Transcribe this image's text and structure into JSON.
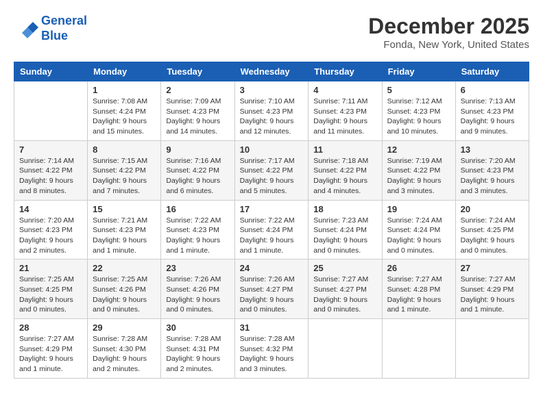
{
  "header": {
    "logo_line1": "General",
    "logo_line2": "Blue",
    "month_title": "December 2025",
    "location": "Fonda, New York, United States"
  },
  "weekdays": [
    "Sunday",
    "Monday",
    "Tuesday",
    "Wednesday",
    "Thursday",
    "Friday",
    "Saturday"
  ],
  "weeks": [
    [
      {
        "day": "",
        "sunrise": "",
        "sunset": "",
        "daylight": ""
      },
      {
        "day": "1",
        "sunrise": "Sunrise: 7:08 AM",
        "sunset": "Sunset: 4:24 PM",
        "daylight": "Daylight: 9 hours and 15 minutes."
      },
      {
        "day": "2",
        "sunrise": "Sunrise: 7:09 AM",
        "sunset": "Sunset: 4:23 PM",
        "daylight": "Daylight: 9 hours and 14 minutes."
      },
      {
        "day": "3",
        "sunrise": "Sunrise: 7:10 AM",
        "sunset": "Sunset: 4:23 PM",
        "daylight": "Daylight: 9 hours and 12 minutes."
      },
      {
        "day": "4",
        "sunrise": "Sunrise: 7:11 AM",
        "sunset": "Sunset: 4:23 PM",
        "daylight": "Daylight: 9 hours and 11 minutes."
      },
      {
        "day": "5",
        "sunrise": "Sunrise: 7:12 AM",
        "sunset": "Sunset: 4:23 PM",
        "daylight": "Daylight: 9 hours and 10 minutes."
      },
      {
        "day": "6",
        "sunrise": "Sunrise: 7:13 AM",
        "sunset": "Sunset: 4:23 PM",
        "daylight": "Daylight: 9 hours and 9 minutes."
      }
    ],
    [
      {
        "day": "7",
        "sunrise": "Sunrise: 7:14 AM",
        "sunset": "Sunset: 4:22 PM",
        "daylight": "Daylight: 9 hours and 8 minutes."
      },
      {
        "day": "8",
        "sunrise": "Sunrise: 7:15 AM",
        "sunset": "Sunset: 4:22 PM",
        "daylight": "Daylight: 9 hours and 7 minutes."
      },
      {
        "day": "9",
        "sunrise": "Sunrise: 7:16 AM",
        "sunset": "Sunset: 4:22 PM",
        "daylight": "Daylight: 9 hours and 6 minutes."
      },
      {
        "day": "10",
        "sunrise": "Sunrise: 7:17 AM",
        "sunset": "Sunset: 4:22 PM",
        "daylight": "Daylight: 9 hours and 5 minutes."
      },
      {
        "day": "11",
        "sunrise": "Sunrise: 7:18 AM",
        "sunset": "Sunset: 4:22 PM",
        "daylight": "Daylight: 9 hours and 4 minutes."
      },
      {
        "day": "12",
        "sunrise": "Sunrise: 7:19 AM",
        "sunset": "Sunset: 4:22 PM",
        "daylight": "Daylight: 9 hours and 3 minutes."
      },
      {
        "day": "13",
        "sunrise": "Sunrise: 7:20 AM",
        "sunset": "Sunset: 4:23 PM",
        "daylight": "Daylight: 9 hours and 3 minutes."
      }
    ],
    [
      {
        "day": "14",
        "sunrise": "Sunrise: 7:20 AM",
        "sunset": "Sunset: 4:23 PM",
        "daylight": "Daylight: 9 hours and 2 minutes."
      },
      {
        "day": "15",
        "sunrise": "Sunrise: 7:21 AM",
        "sunset": "Sunset: 4:23 PM",
        "daylight": "Daylight: 9 hours and 1 minute."
      },
      {
        "day": "16",
        "sunrise": "Sunrise: 7:22 AM",
        "sunset": "Sunset: 4:23 PM",
        "daylight": "Daylight: 9 hours and 1 minute."
      },
      {
        "day": "17",
        "sunrise": "Sunrise: 7:22 AM",
        "sunset": "Sunset: 4:24 PM",
        "daylight": "Daylight: 9 hours and 1 minute."
      },
      {
        "day": "18",
        "sunrise": "Sunrise: 7:23 AM",
        "sunset": "Sunset: 4:24 PM",
        "daylight": "Daylight: 9 hours and 0 minutes."
      },
      {
        "day": "19",
        "sunrise": "Sunrise: 7:24 AM",
        "sunset": "Sunset: 4:24 PM",
        "daylight": "Daylight: 9 hours and 0 minutes."
      },
      {
        "day": "20",
        "sunrise": "Sunrise: 7:24 AM",
        "sunset": "Sunset: 4:25 PM",
        "daylight": "Daylight: 9 hours and 0 minutes."
      }
    ],
    [
      {
        "day": "21",
        "sunrise": "Sunrise: 7:25 AM",
        "sunset": "Sunset: 4:25 PM",
        "daylight": "Daylight: 9 hours and 0 minutes."
      },
      {
        "day": "22",
        "sunrise": "Sunrise: 7:25 AM",
        "sunset": "Sunset: 4:26 PM",
        "daylight": "Daylight: 9 hours and 0 minutes."
      },
      {
        "day": "23",
        "sunrise": "Sunrise: 7:26 AM",
        "sunset": "Sunset: 4:26 PM",
        "daylight": "Daylight: 9 hours and 0 minutes."
      },
      {
        "day": "24",
        "sunrise": "Sunrise: 7:26 AM",
        "sunset": "Sunset: 4:27 PM",
        "daylight": "Daylight: 9 hours and 0 minutes."
      },
      {
        "day": "25",
        "sunrise": "Sunrise: 7:27 AM",
        "sunset": "Sunset: 4:27 PM",
        "daylight": "Daylight: 9 hours and 0 minutes."
      },
      {
        "day": "26",
        "sunrise": "Sunrise: 7:27 AM",
        "sunset": "Sunset: 4:28 PM",
        "daylight": "Daylight: 9 hours and 1 minute."
      },
      {
        "day": "27",
        "sunrise": "Sunrise: 7:27 AM",
        "sunset": "Sunset: 4:29 PM",
        "daylight": "Daylight: 9 hours and 1 minute."
      }
    ],
    [
      {
        "day": "28",
        "sunrise": "Sunrise: 7:27 AM",
        "sunset": "Sunset: 4:29 PM",
        "daylight": "Daylight: 9 hours and 1 minute."
      },
      {
        "day": "29",
        "sunrise": "Sunrise: 7:28 AM",
        "sunset": "Sunset: 4:30 PM",
        "daylight": "Daylight: 9 hours and 2 minutes."
      },
      {
        "day": "30",
        "sunrise": "Sunrise: 7:28 AM",
        "sunset": "Sunset: 4:31 PM",
        "daylight": "Daylight: 9 hours and 2 minutes."
      },
      {
        "day": "31",
        "sunrise": "Sunrise: 7:28 AM",
        "sunset": "Sunset: 4:32 PM",
        "daylight": "Daylight: 9 hours and 3 minutes."
      },
      {
        "day": "",
        "sunrise": "",
        "sunset": "",
        "daylight": ""
      },
      {
        "day": "",
        "sunrise": "",
        "sunset": "",
        "daylight": ""
      },
      {
        "day": "",
        "sunrise": "",
        "sunset": "",
        "daylight": ""
      }
    ]
  ]
}
